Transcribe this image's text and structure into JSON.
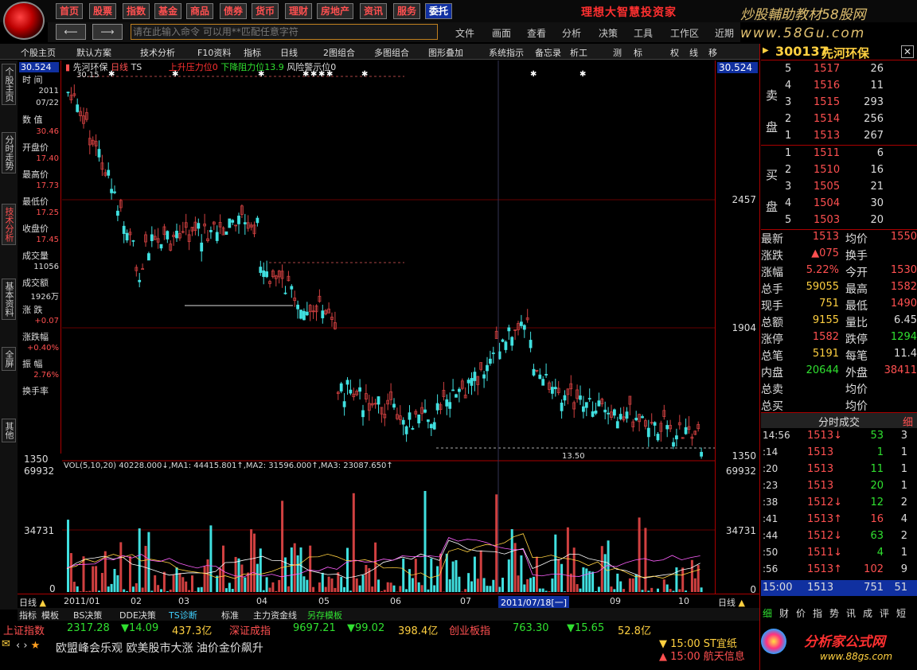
{
  "topmenu": [
    "首页",
    "股票",
    "指数",
    "基金",
    "商品",
    "债券",
    "货币",
    "理财",
    "房地产",
    "资讯",
    "服务",
    "委托"
  ],
  "brand": {
    "slogan": "理想大智慧投资家",
    "site_name": "炒股輔助教材58股网",
    "site_url": "www.58Gu.com"
  },
  "command": {
    "placeholder": "请在此输入命令  可以用**匹配任意字符"
  },
  "menu2": [
    "文件",
    "画面",
    "查看",
    "分析",
    "决策",
    "工具",
    "工作区",
    "近期"
  ],
  "toolbar3": [
    "个股主页",
    "默认方案",
    "技术分析",
    "F10资料",
    "指标",
    "日线",
    "2图组合",
    "多图组合",
    "图形叠加",
    "系统指示",
    "备忘录",
    "析工",
    "测",
    "标",
    "权",
    "线",
    "移"
  ],
  "left_tabs": [
    "个股主页",
    "分时走势",
    "技术分析",
    "基本资料",
    "全屏",
    "其他"
  ],
  "info": {
    "price_top": "30.524",
    "time_label": "时 间",
    "time_year": "2011",
    "time_date": "07/22",
    "value_label": "数 值",
    "value": "30.46",
    "open_label": "开盘价",
    "open": "17.40",
    "high_label": "最高价",
    "high": "17.73",
    "low_label": "最低价",
    "low": "17.25",
    "close_label": "收盘价",
    "close": "17.45",
    "vol_label": "成交量",
    "vol": "11056",
    "amt_label": "成交额",
    "amt": "1926万",
    "chg_label": "涨 跌",
    "chg": "+0.07",
    "pct_label": "涨跌幅",
    "pct": "+0.40%",
    "amp_label": "振 幅",
    "amp": "2.76%",
    "turn_label": "换手率"
  },
  "chart": {
    "title": "先河环保",
    "period": "日线",
    "ts": "TS",
    "legend1": "上升压力位0",
    "legend2": "下降阻力位13.9",
    "legend3": "风险警示位0",
    "top_price": "30.15",
    "low_note": "13.50",
    "axis": [
      "30.524",
      "2457",
      "1904",
      "1350",
      "69932",
      "34731",
      "0"
    ],
    "vol_legend": "VOL(5,10,20) 40228.000↓,MA1: 44415.801↑,MA2: 31596.000↑,MA3: 23087.650↑",
    "date_labels": [
      "2011/01",
      "02",
      "03",
      "04",
      "05",
      "06",
      "07",
      "2011/07/18[一]",
      "09",
      "10"
    ],
    "period_left": "日线",
    "period_right": "日线"
  },
  "bottom_tabs": [
    "指标",
    "模板",
    "BS决策",
    "DDE决策",
    "TS诊断",
    "标准",
    "主力资金线",
    "另存模板"
  ],
  "indices": [
    {
      "name": "上证指数",
      "val": "2317.28",
      "chg": "▼14.09",
      "amt": "437.3亿"
    },
    {
      "name": "深证成指",
      "val": "9697.21",
      "chg": "▼99.02",
      "amt": "398.4亿"
    },
    {
      "name": "创业板指",
      "val": "763.30",
      "chg": "▼15.65",
      "amt": "52.8亿"
    }
  ],
  "news": {
    "headline": "欧盟峰会乐观 欧美股市大涨 油价金价飙升",
    "alert1": "15:00 ST宜纸",
    "alert2": "15:00 航天信息",
    "logo_text": "分析家公式网",
    "logo_url": "www.88gs.com"
  },
  "quote": {
    "code": "300137",
    "name": "先河环保",
    "sell_label": "卖盘",
    "buy_label": "买盘",
    "sell": [
      [
        "5",
        "1517",
        "26"
      ],
      [
        "4",
        "1516",
        "11"
      ],
      [
        "3",
        "1515",
        "293"
      ],
      [
        "2",
        "1514",
        "256"
      ],
      [
        "1",
        "1513",
        "267"
      ]
    ],
    "buy": [
      [
        "1",
        "1511",
        "6"
      ],
      [
        "2",
        "1510",
        "16"
      ],
      [
        "3",
        "1505",
        "21"
      ],
      [
        "4",
        "1504",
        "30"
      ],
      [
        "5",
        "1503",
        "20"
      ]
    ],
    "stats": [
      [
        "最新",
        "1513",
        "均价",
        "1550"
      ],
      [
        "涨跌",
        "▲075",
        "换手",
        ""
      ],
      [
        "涨幅",
        "5.22%",
        "今开",
        "1530"
      ],
      [
        "总手",
        "59055",
        "最高",
        "1582"
      ],
      [
        "现手",
        "751",
        "最低",
        "1490"
      ],
      [
        "总额",
        "9155",
        "量比",
        "6.45"
      ],
      [
        "涨停",
        "1582",
        "跌停",
        "1294"
      ],
      [
        "总笔",
        "5191",
        "每笔",
        "11.4"
      ],
      [
        "内盘",
        "20644",
        "外盘",
        "38411"
      ],
      [
        "总卖",
        "",
        "均价",
        ""
      ],
      [
        "总买",
        "",
        "均价",
        ""
      ]
    ],
    "tick_title": "分时成交",
    "tick_btn": "细",
    "ticks": [
      [
        "14:56",
        "1513↓",
        "53",
        "3"
      ],
      [
        ":14",
        "1513",
        "1",
        "1"
      ],
      [
        ":20",
        "1513",
        "11",
        "1"
      ],
      [
        ":23",
        "1513",
        "20",
        "1"
      ],
      [
        ":38",
        "1512↓",
        "12",
        "2"
      ],
      [
        ":41",
        "1513↑",
        "16",
        "4"
      ],
      [
        ":44",
        "1512↓",
        "63",
        "2"
      ],
      [
        ":50",
        "1511↓",
        "4",
        "1"
      ],
      [
        ":56",
        "1513↑",
        "102",
        "9"
      ]
    ],
    "last_tick": [
      "15:00",
      "1513",
      "751",
      "51"
    ],
    "bottom_tabs": [
      "细",
      "财",
      "价",
      "指",
      "势",
      "讯",
      "成",
      "评",
      "短"
    ]
  }
}
